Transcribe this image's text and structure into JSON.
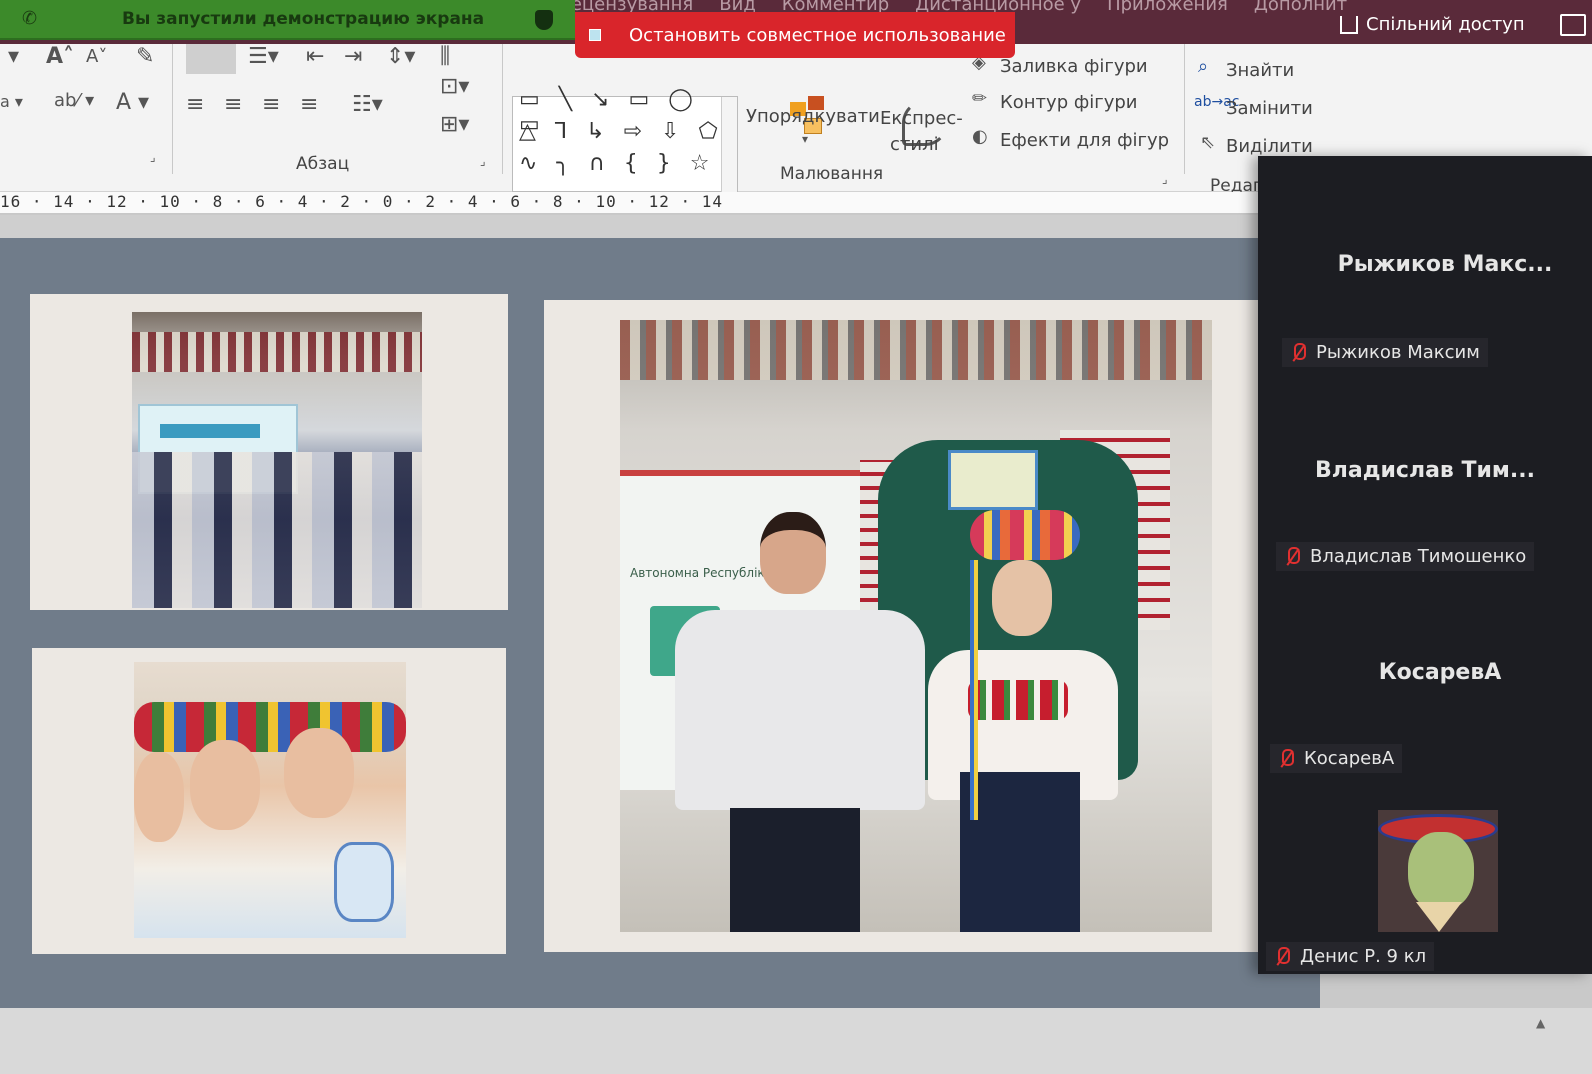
{
  "window": {
    "menu_tabs": [
      "Рецензування",
      "Вид",
      "Комментир",
      "Дистанционное у",
      "Приложения",
      "Дополнит"
    ],
    "share_label": "Спільний доступ"
  },
  "share_banner": {
    "text": "Вы запустили демонстрацию экрана",
    "stop_label": "Остановить совместное использование"
  },
  "ribbon": {
    "paragraph_group": "Абзац",
    "drawing_group": "Малювання",
    "editing_group": "Редагува",
    "arrange_label": "Упорядкувати",
    "quick_styles_label": "Експрес-",
    "quick_styles_label2": "стилі",
    "shape_fill": "Заливка фігури",
    "shape_outline": "Контур фігури",
    "shape_effects": "Ефекти для фігур",
    "find": "Знайти",
    "replace": "Замінити",
    "select": "Виділити"
  },
  "ruler": {
    "labels": "16 · 14 · 12 · 10 · 8 · 6 · 4 · 2 · 0 · 2 · 4 · 6 · 8 · 10 · 12 · 14"
  },
  "slide": {
    "banner_text": "Автономна Республіка Кр"
  },
  "participants": [
    {
      "display_name": "Рыжиков Макс...",
      "label": "Рыжиков Максим"
    },
    {
      "display_name": "Владислав Тим...",
      "label": "Владислав Тимошенко"
    },
    {
      "display_name": "КосаревА",
      "label": "КосаревА"
    },
    {
      "display_name": "",
      "label": "Денис Р. 9 кл"
    }
  ],
  "colors": {
    "banner_green": "#3c8a2a",
    "stop_red": "#d9252b",
    "title_bar": "#5a2a3a",
    "panel_bg": "#1c1d22",
    "muted_icon": "#e03030"
  }
}
